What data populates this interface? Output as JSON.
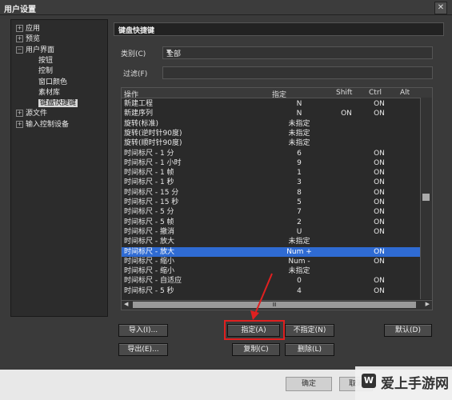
{
  "window": {
    "title": "用户设置",
    "close_glyph": "✕"
  },
  "tree": {
    "items": [
      {
        "label": "应用",
        "expander": "+"
      },
      {
        "label": "预览",
        "expander": "+"
      },
      {
        "label": "用户界面",
        "expander": "−"
      },
      {
        "label": "按钮"
      },
      {
        "label": "控制"
      },
      {
        "label": "窗口颜色"
      },
      {
        "label": "素材库"
      },
      {
        "label": "键盘快捷键",
        "selected": true
      },
      {
        "label": "源文件",
        "expander": "+"
      },
      {
        "label": "输入控制设备",
        "expander": "+"
      }
    ]
  },
  "panel": {
    "title": "键盘快捷键"
  },
  "category": {
    "label": "类别(C)",
    "value": "全部"
  },
  "filter": {
    "label": "过滤(F)",
    "value": ""
  },
  "table": {
    "headers": {
      "action": "操作",
      "assign": "指定",
      "shift": "Shift",
      "ctrl": "Ctrl",
      "alt": "Alt"
    },
    "rows": [
      {
        "action": "新建工程",
        "assign": "N",
        "shift": "",
        "ctrl": "ON",
        "alt": ""
      },
      {
        "action": "新建序列",
        "assign": "N",
        "shift": "ON",
        "ctrl": "ON",
        "alt": ""
      },
      {
        "action": "旋转(标准)",
        "assign": "未指定",
        "shift": "",
        "ctrl": "",
        "alt": ""
      },
      {
        "action": "旋转(逆时针90度)",
        "assign": "未指定",
        "shift": "",
        "ctrl": "",
        "alt": ""
      },
      {
        "action": "旋转(顺时针90度)",
        "assign": "未指定",
        "shift": "",
        "ctrl": "",
        "alt": ""
      },
      {
        "action": "时间标尺 - 1 分",
        "assign": "6",
        "shift": "",
        "ctrl": "ON",
        "alt": ""
      },
      {
        "action": "时间标尺 - 1 小时",
        "assign": "9",
        "shift": "",
        "ctrl": "ON",
        "alt": ""
      },
      {
        "action": "时间标尺 - 1 帧",
        "assign": "1",
        "shift": "",
        "ctrl": "ON",
        "alt": ""
      },
      {
        "action": "时间标尺 - 1 秒",
        "assign": "3",
        "shift": "",
        "ctrl": "ON",
        "alt": ""
      },
      {
        "action": "时间标尺 - 15 分",
        "assign": "8",
        "shift": "",
        "ctrl": "ON",
        "alt": ""
      },
      {
        "action": "时间标尺 - 15 秒",
        "assign": "5",
        "shift": "",
        "ctrl": "ON",
        "alt": ""
      },
      {
        "action": "时间标尺 - 5 分",
        "assign": "7",
        "shift": "",
        "ctrl": "ON",
        "alt": ""
      },
      {
        "action": "时间标尺 - 5 帧",
        "assign": "2",
        "shift": "",
        "ctrl": "ON",
        "alt": ""
      },
      {
        "action": "时间标尺 - 撤消",
        "assign": "U",
        "shift": "",
        "ctrl": "ON",
        "alt": ""
      },
      {
        "action": "时间标尺 - 放大",
        "assign": "未指定",
        "shift": "",
        "ctrl": "",
        "alt": ""
      },
      {
        "action": "时间标尺 - 放大",
        "assign": "Num +",
        "shift": "",
        "ctrl": "ON",
        "alt": "",
        "selected": true
      },
      {
        "action": "时间标尺 - 缩小",
        "assign": "Num -",
        "shift": "",
        "ctrl": "ON",
        "alt": ""
      },
      {
        "action": "时间标尺 - 缩小",
        "assign": "未指定",
        "shift": "",
        "ctrl": "",
        "alt": ""
      },
      {
        "action": "时间标尺 - 自适应",
        "assign": "0",
        "shift": "",
        "ctrl": "ON",
        "alt": ""
      },
      {
        "action": "时间标尺 - 5 秒",
        "assign": "4",
        "shift": "",
        "ctrl": "ON",
        "alt": ""
      }
    ],
    "hscroll_glyph": "Ⅲ"
  },
  "buttons": {
    "import": "导入(I)...",
    "export": "导出(E)...",
    "assign": "指定(A)",
    "unassign": "不指定(N)",
    "copy": "复制(C)",
    "delete": "删除(L)",
    "default": "默认(D)",
    "ok": "确定",
    "cancel": "取消"
  },
  "watermark": {
    "text": "爱上手游网",
    "logo_glyph": "W"
  },
  "colors": {
    "selection": "#2f6bd3",
    "annotation": "#e02020"
  }
}
